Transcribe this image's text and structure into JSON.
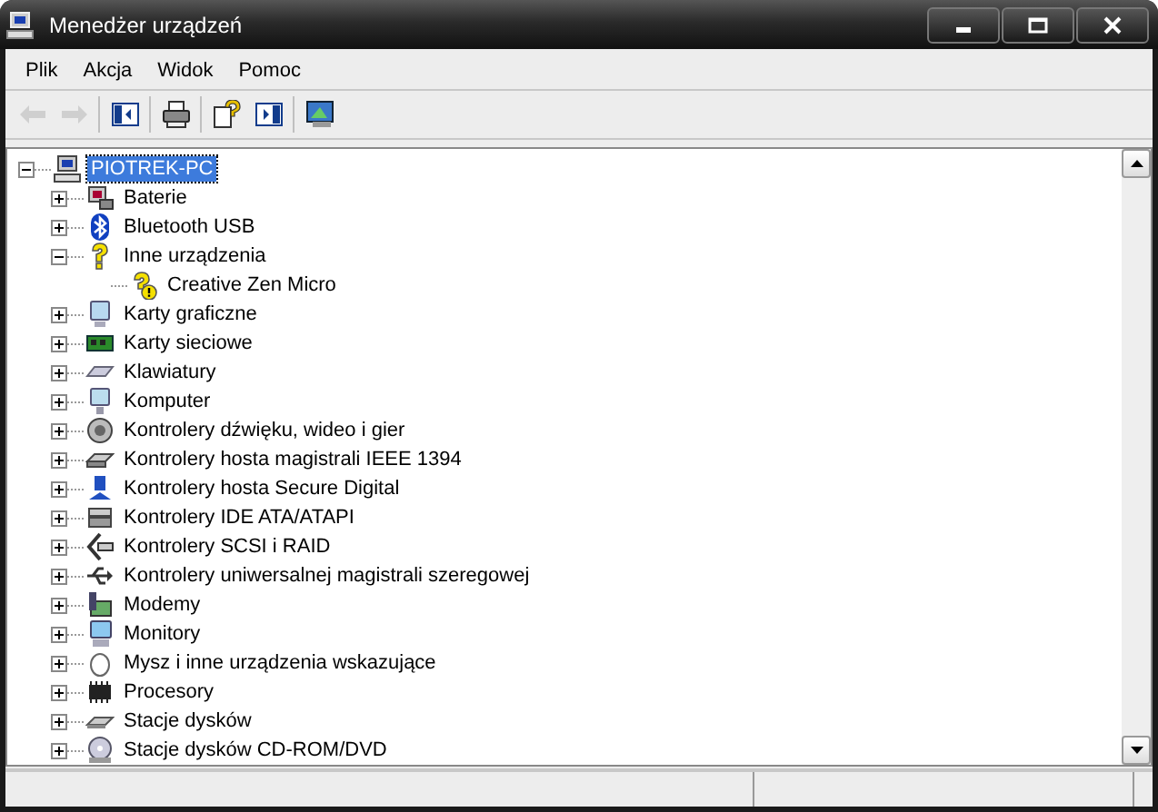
{
  "window": {
    "title": "Menedżer urządzeń"
  },
  "menu": [
    "Plik",
    "Akcja",
    "Widok",
    "Pomoc"
  ],
  "toolbar": [
    {
      "kind": "back",
      "disabled": true
    },
    {
      "kind": "forward",
      "disabled": true
    },
    {
      "kind": "tree",
      "disabled": false
    },
    {
      "kind": "print",
      "disabled": false
    },
    {
      "kind": "help",
      "disabled": false
    },
    {
      "kind": "panel",
      "disabled": false
    },
    {
      "kind": "scan",
      "disabled": false
    }
  ],
  "tree": {
    "label": "PIOTREK-PC",
    "selected": true,
    "expanded": true,
    "children": [
      {
        "label": "Baterie",
        "selected": false,
        "expanded": false
      },
      {
        "label": "Bluetooth USB",
        "selected": false,
        "expanded": false
      },
      {
        "label": "Inne urządzenia",
        "selected": false,
        "expanded": true,
        "children": [
          {
            "label": "Creative Zen Micro",
            "selected": false
          }
        ]
      },
      {
        "label": "Karty graficzne",
        "selected": false,
        "expanded": false
      },
      {
        "label": "Karty sieciowe",
        "selected": false,
        "expanded": false
      },
      {
        "label": "Klawiatury",
        "selected": false,
        "expanded": false
      },
      {
        "label": "Komputer",
        "selected": false,
        "expanded": false
      },
      {
        "label": "Kontrolery dźwięku, wideo i gier",
        "selected": false,
        "expanded": false
      },
      {
        "label": "Kontrolery hosta magistrali IEEE 1394",
        "selected": false,
        "expanded": false
      },
      {
        "label": "Kontrolery hosta Secure Digital",
        "selected": false,
        "expanded": false
      },
      {
        "label": "Kontrolery IDE ATA/ATAPI",
        "selected": false,
        "expanded": false
      },
      {
        "label": "Kontrolery SCSI i RAID",
        "selected": false,
        "expanded": false
      },
      {
        "label": "Kontrolery uniwersalnej magistrali szeregowej",
        "selected": false,
        "expanded": false
      },
      {
        "label": "Modemy",
        "selected": false,
        "expanded": false
      },
      {
        "label": "Monitory",
        "selected": false,
        "expanded": false
      },
      {
        "label": "Mysz i inne urządzenia wskazujące",
        "selected": false,
        "expanded": false
      },
      {
        "label": "Procesory",
        "selected": false,
        "expanded": false
      },
      {
        "label": "Stacje dysków",
        "selected": false,
        "expanded": false
      },
      {
        "label": "Stacje dysków CD-ROM/DVD",
        "selected": false,
        "expanded": false
      }
    ]
  }
}
